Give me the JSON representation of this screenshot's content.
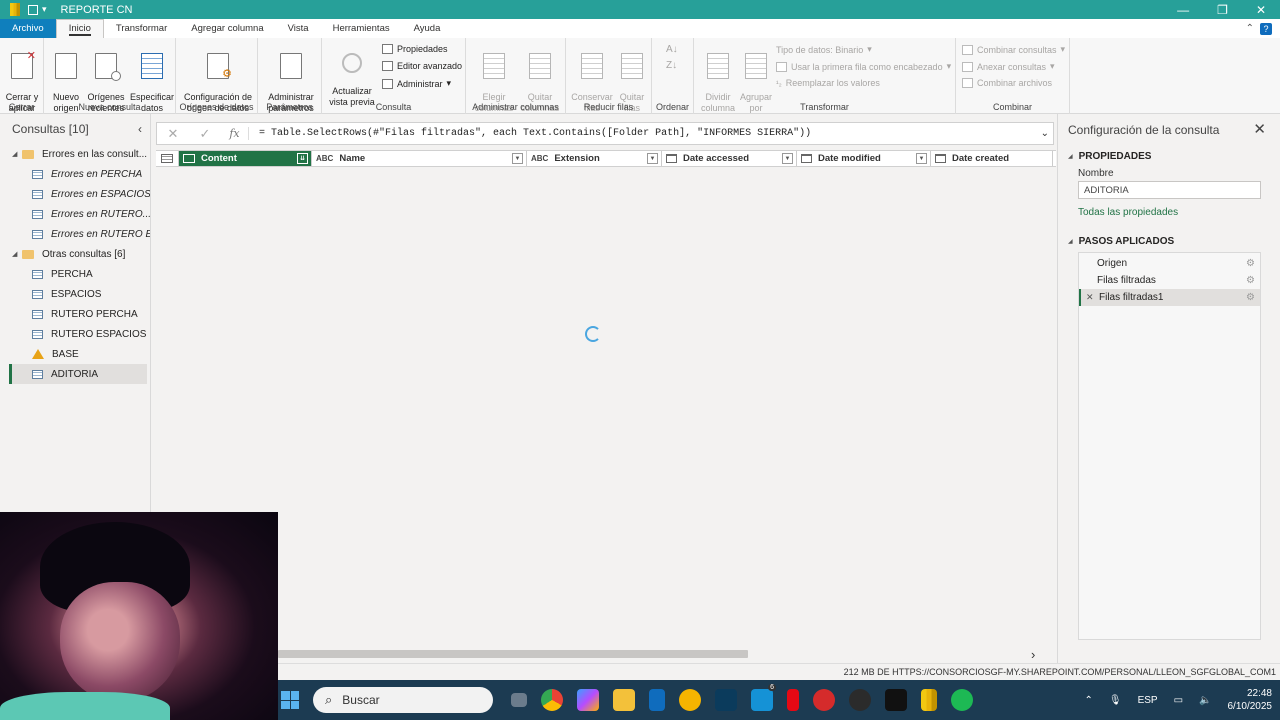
{
  "window": {
    "title": "REPORTE CN"
  },
  "tabs": [
    "Archivo",
    "Inicio",
    "Transformar",
    "Agregar columna",
    "Vista",
    "Herramientas",
    "Ayuda"
  ],
  "ribbon": {
    "cerrar": {
      "btn": "Cerrar y\naplicar",
      "label": "Cerrar"
    },
    "nueva_consulta": {
      "nuevo": "Nuevo\norigen",
      "origenes": "Orígenes\nrecientes",
      "especificar": "Especificar\ndatos",
      "label": "Nueva consulta"
    },
    "origenes": {
      "config": "Configuración de\norigen de datos",
      "label": "Orígenes de datos"
    },
    "parametros": {
      "admin": "Administrar\nparámetros",
      "label": "Parámetros"
    },
    "consulta": {
      "actualizar": "Actualizar\nvista previa",
      "propiedades": "Propiedades",
      "editor": "Editor avanzado",
      "administrar": "Administrar",
      "label": "Consulta"
    },
    "admin_columnas": {
      "elegir": "Elegir\ncolumnas",
      "quitar": "Quitar\ncolumnas",
      "label": "Administrar columnas"
    },
    "reducir": {
      "conservar": "Conservar\nfilas",
      "quitar": "Quitar\nfilas",
      "label": "Reducir filas"
    },
    "ordenar": {
      "label": "Ordenar"
    },
    "transformar": {
      "dividir": "Dividir\ncolumna",
      "agrupar": "Agrupar\npor",
      "tipo": "Tipo de datos: Binario",
      "primera_fila": "Usar la primera fila como encabezado",
      "reemplazar": "Reemplazar los valores",
      "label": "Transformar"
    },
    "combinar": {
      "combinar_consultas": "Combinar consultas",
      "anexar": "Anexar consultas",
      "archivos": "Combinar archivos",
      "label": "Combinar"
    }
  },
  "queries": {
    "header": "Consultas [10]",
    "groups": [
      {
        "name": "Errores en las consult...",
        "items": [
          "Errores en PERCHA",
          "Errores en ESPACIOS",
          "Errores en RUTERO...",
          "Errores en RUTERO E..."
        ]
      },
      {
        "name": "Otras consultas [6]",
        "items": [
          "PERCHA",
          "ESPACIOS",
          "RUTERO PERCHA",
          "RUTERO ESPACIOS",
          "BASE",
          "ADITORIA"
        ]
      }
    ]
  },
  "formula": "= Table.SelectRows(#\"Filas filtradas\", each Text.Contains([Folder Path], \"INFORMES SIERRA\"))",
  "columns": [
    "Content",
    "Name",
    "Extension",
    "Date accessed",
    "Date modified",
    "Date created"
  ],
  "query_settings": {
    "title": "Configuración de la consulta",
    "properties_header": "PROPIEDADES",
    "name_label": "Nombre",
    "name_value": "ADITORIA",
    "all_properties": "Todas las propiedades",
    "steps_header": "PASOS APLICADOS",
    "steps": [
      "Origen",
      "Filas filtradas",
      "Filas filtradas1"
    ]
  },
  "status": "212 MB DE HTTPS://CONSORCIOSGF-MY.SHAREPOINT.COM/PERSONAL/LLEON_SGFGLOBAL_COM1",
  "taskbar": {
    "search_placeholder": "Buscar",
    "badge": "6",
    "lang": "ESP",
    "time": "22:48",
    "date": "6/10/2025"
  },
  "colors": {
    "accent": "#217346",
    "titlebar": "#27a099",
    "taskbar": "#1c3b52"
  }
}
